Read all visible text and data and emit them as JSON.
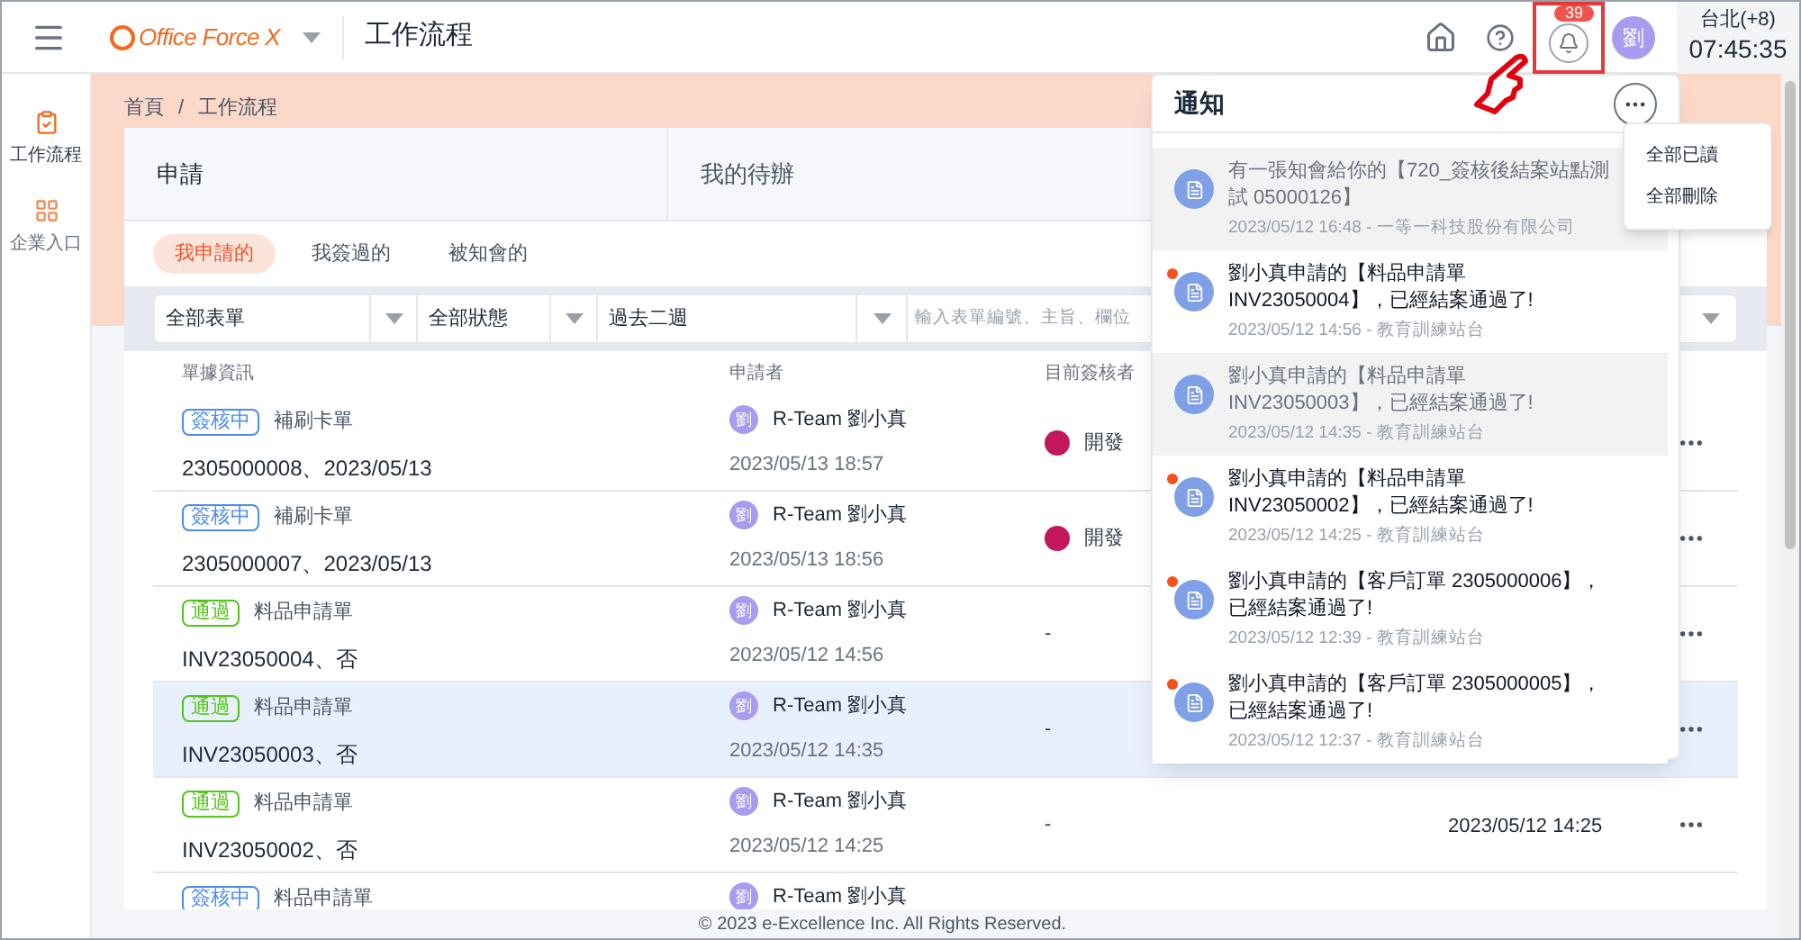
{
  "header": {
    "logo": "Office Force X",
    "title": "工作流程",
    "badge": "39",
    "avatar": "劉",
    "timezone": "台北(+8)",
    "time": "07:45:35"
  },
  "sidebar": [
    {
      "label": "工作流程",
      "selected": true,
      "kind": "check"
    },
    {
      "label": "企業入口",
      "selected": false,
      "kind": "grid"
    }
  ],
  "breadcrumb": [
    "首頁",
    "工作流程"
  ],
  "breadcrumb_separator": "/",
  "main_tabs": [
    {
      "label": "申請",
      "selected": true
    },
    {
      "label": "我的待辦",
      "selected": false
    }
  ],
  "sub_tabs": [
    {
      "label": "我申請的",
      "selected": true
    },
    {
      "label": "我簽過的",
      "selected": false
    },
    {
      "label": "被知會的",
      "selected": false
    }
  ],
  "filters": {
    "form": "全部表單",
    "status": "全部狀態",
    "period": "過去二週",
    "search_placeholder": "輸入表單編號、主旨、欄位"
  },
  "table": {
    "columns": [
      "單據資訊",
      "申請者",
      "目前簽核者"
    ],
    "rows": [
      {
        "status": {
          "text": "簽核中",
          "color": "#4a8af4"
        },
        "form": "補刷卡單",
        "info": "2305000008、2023/05/13",
        "applicant": "R-Team 劉小真",
        "applicant_avatar": "劉",
        "applied": "2023/05/13 18:57",
        "approver": "開發",
        "selected": false
      },
      {
        "status": {
          "text": "簽核中",
          "color": "#4a8af4"
        },
        "form": "補刷卡單",
        "info": "2305000007、2023/05/13",
        "applicant": "R-Team 劉小真",
        "applicant_avatar": "劉",
        "applied": "2023/05/13 18:56",
        "approver": "開發",
        "selected": false
      },
      {
        "status": {
          "text": "通過",
          "color": "#52c41a"
        },
        "form": "料品申請單",
        "info": "INV23050004、否",
        "applicant": "R-Team 劉小真",
        "applicant_avatar": "劉",
        "applied": "2023/05/12 14:56",
        "approver": "-",
        "selected": false
      },
      {
        "status": {
          "text": "通過",
          "color": "#52c41a"
        },
        "form": "料品申請單",
        "info": "INV23050003、否",
        "applicant": "R-Team 劉小真",
        "applicant_avatar": "劉",
        "applied": "2023/05/12 14:35",
        "approver": "-",
        "selected": true
      },
      {
        "status": {
          "text": "通過",
          "color": "#52c41a"
        },
        "form": "料品申請單",
        "info": "INV23050002、否",
        "applicant": "R-Team 劉小真",
        "applicant_avatar": "劉",
        "applied": "2023/05/12 14:25",
        "approver": "-",
        "date": "2023/05/12 14:25",
        "selected": false
      },
      {
        "status": {
          "text": "簽核中",
          "color": "#4a8af4"
        },
        "form": "料品申請單",
        "applicant": "R-Team 劉小真",
        "applicant_avatar": "劉",
        "selected": false
      }
    ]
  },
  "notifications": {
    "title": "通知",
    "items": [
      {
        "text": "有一張知會給你的【720_簽核後結案站點測試 05000126】",
        "meta": "2023/05/12 16:48 - 一等一科技股份有限公司",
        "unread": false
      },
      {
        "text": "劉小真申請的【料品申請單 INV23050004】，已經結案通過了!",
        "meta": "2023/05/12 14:56 - 教育訓練站台",
        "unread": true
      },
      {
        "text": "劉小真申請的【料品申請單 INV23050003】，已經結案通過了!",
        "meta": "2023/05/12 14:35 - 教育訓練站台",
        "unread": false
      },
      {
        "text": "劉小真申請的【料品申請單 INV23050002】，已經結案通過了!",
        "meta": "2023/05/12 14:25 - 教育訓練站台",
        "unread": true
      },
      {
        "text": "劉小真申請的【客戶訂單 2305000006】，已經結案通過了!",
        "meta": "2023/05/12 12:39 - 教育訓練站台",
        "unread": true
      },
      {
        "text": "劉小真申請的【客戶訂單 2305000005】，已經結案通過了!",
        "meta": "2023/05/12 12:37 - 教育訓練站台",
        "unread": true
      }
    ],
    "menu": [
      "全部已讀",
      "全部刪除"
    ]
  },
  "footer": "© 2023 e-Excellence Inc. All Rights Reserved."
}
